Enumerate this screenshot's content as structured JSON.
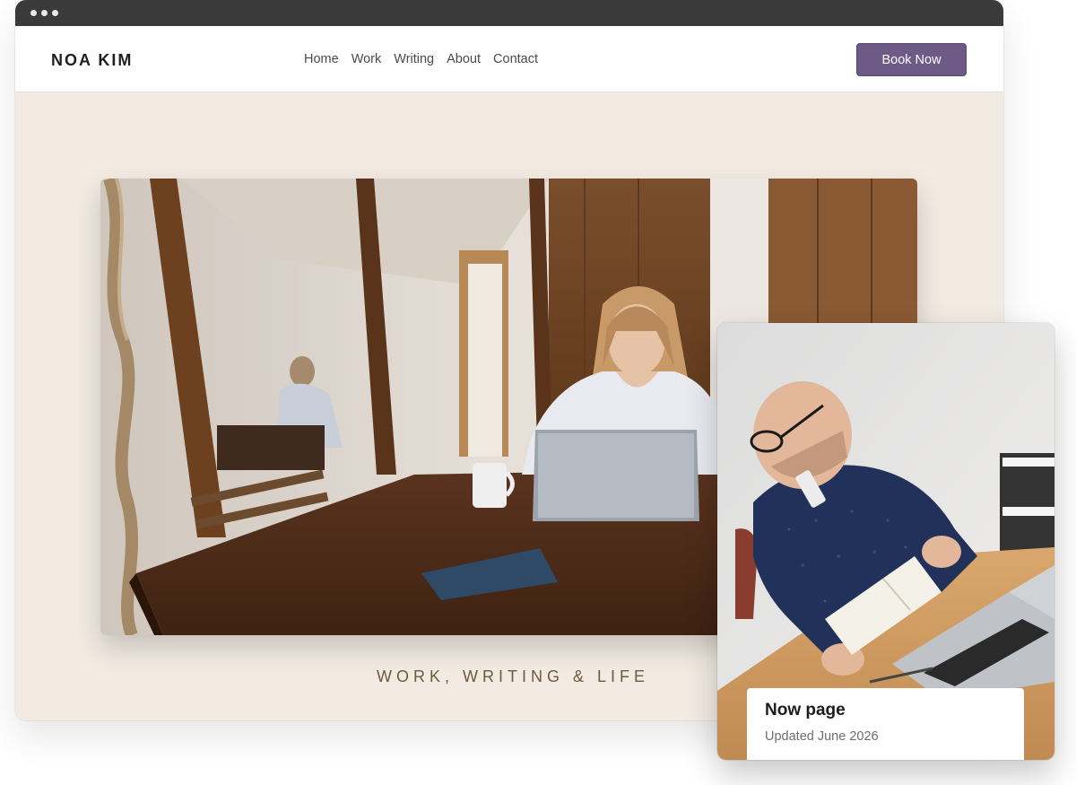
{
  "site": {
    "brand": "NOA KIM",
    "nav": [
      "Home",
      "Work",
      "Writing",
      "About",
      "Contact"
    ],
    "book_button": "Book Now",
    "tagline": "WORK, WRITING & LIFE"
  },
  "card": {
    "title": "Now page",
    "subtitle": "Updated June 2026"
  },
  "colors": {
    "accent": "#6e5a86",
    "page_background": "#f3ebe2",
    "tagline": "#6b5a3e",
    "titlebar": "#3a3a3a"
  }
}
